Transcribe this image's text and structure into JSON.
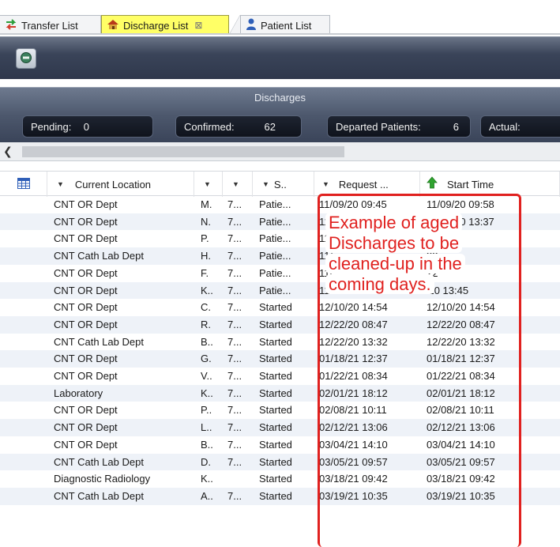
{
  "tabs": [
    {
      "label": "Transfer List",
      "icon": "transfer-arrows-icon"
    },
    {
      "label": "Discharge List",
      "icon": "house-icon",
      "close": "⊠"
    },
    {
      "label": "Patient List",
      "icon": "person-icon"
    }
  ],
  "panel": {
    "title": "Discharges",
    "counters": [
      {
        "label": "Pending:",
        "value": "0"
      },
      {
        "label": "Confirmed:",
        "value": "62"
      },
      {
        "label": "Departed Patients:",
        "value": "6"
      },
      {
        "label": "Actual:",
        "value": ""
      }
    ]
  },
  "columns": [
    "Current Location",
    "",
    "",
    "S..",
    "Request ...",
    "Start Time"
  ],
  "rows": [
    {
      "loc": "CNT OR Dept",
      "a": "M.",
      "b": "7...",
      "s": "Patie...",
      "req": "11/09/20 09:45",
      "start": "11/09/20 09:58"
    },
    {
      "loc": "CNT OR Dept",
      "a": "N.",
      "b": "7...",
      "s": "Patie...",
      "req": "11/10/20 13:37",
      "start": "11/10/20 13:37"
    },
    {
      "loc": "CNT OR Dept",
      "a": "P.",
      "b": "7...",
      "s": "Patie...",
      "req": "11/",
      "start": "01"
    },
    {
      "loc": "CNT Cath Lab Dept",
      "a": "H.",
      "b": "7...",
      "s": "Patie...",
      "req": "11/",
      "start": "33"
    },
    {
      "loc": "CNT OR Dept",
      "a": "F.",
      "b": "7...",
      "s": "Patie...",
      "req": "11/",
      "start": "22"
    },
    {
      "loc": "CNT OR Dept",
      "a": "K..",
      "b": "7...",
      "s": "Patie...",
      "req": "11/",
      "start": "'20 13:45"
    },
    {
      "loc": "CNT OR Dept",
      "a": "C.",
      "b": "7...",
      "s": "Started",
      "req": "12/10/20 14:54",
      "start": "12/10/20 14:54"
    },
    {
      "loc": "CNT OR Dept",
      "a": "R.",
      "b": "7...",
      "s": "Started",
      "req": "12/22/20 08:47",
      "start": "12/22/20 08:47"
    },
    {
      "loc": "CNT Cath Lab Dept",
      "a": "B..",
      "b": "7...",
      "s": "Started",
      "req": "12/22/20 13:32",
      "start": "12/22/20 13:32"
    },
    {
      "loc": "CNT OR Dept",
      "a": "G.",
      "b": "7...",
      "s": "Started",
      "req": "01/18/21 12:37",
      "start": "01/18/21 12:37"
    },
    {
      "loc": "CNT OR Dept",
      "a": "V..",
      "b": "7...",
      "s": "Started",
      "req": "01/22/21 08:34",
      "start": "01/22/21 08:34"
    },
    {
      "loc": "Laboratory",
      "a": "K..",
      "b": "7...",
      "s": "Started",
      "req": "02/01/21 18:12",
      "start": "02/01/21 18:12"
    },
    {
      "loc": "CNT OR Dept",
      "a": "P..",
      "b": "7...",
      "s": "Started",
      "req": "02/08/21 10:11",
      "start": "02/08/21 10:11"
    },
    {
      "loc": "CNT OR Dept",
      "a": "L..",
      "b": "7...",
      "s": "Started",
      "req": "02/12/21 13:06",
      "start": "02/12/21 13:06"
    },
    {
      "loc": "CNT OR Dept",
      "a": "B..",
      "b": "7...",
      "s": "Started",
      "req": "03/04/21 14:10",
      "start": "03/04/21 14:10"
    },
    {
      "loc": "CNT Cath Lab Dept",
      "a": "D.",
      "b": "7...",
      "s": "Started",
      "req": "03/05/21 09:57",
      "start": "03/05/21 09:57"
    },
    {
      "loc": "Diagnostic Radiology",
      "a": "K..",
      "b": "",
      "s": "Started",
      "req": "03/18/21 09:42",
      "start": "03/18/21 09:42"
    },
    {
      "loc": "CNT Cath Lab Dept",
      "a": "A..",
      "b": "7...",
      "s": "Started",
      "req": "03/19/21 10:35",
      "start": "03/19/21 10:35"
    }
  ],
  "callout": "Example of aged Discharges to be cleaned-up in the coming days.",
  "colors": {
    "highlight": "#e0211f",
    "active_tab": "#ffff66",
    "sort_up": "#2fa32f"
  }
}
